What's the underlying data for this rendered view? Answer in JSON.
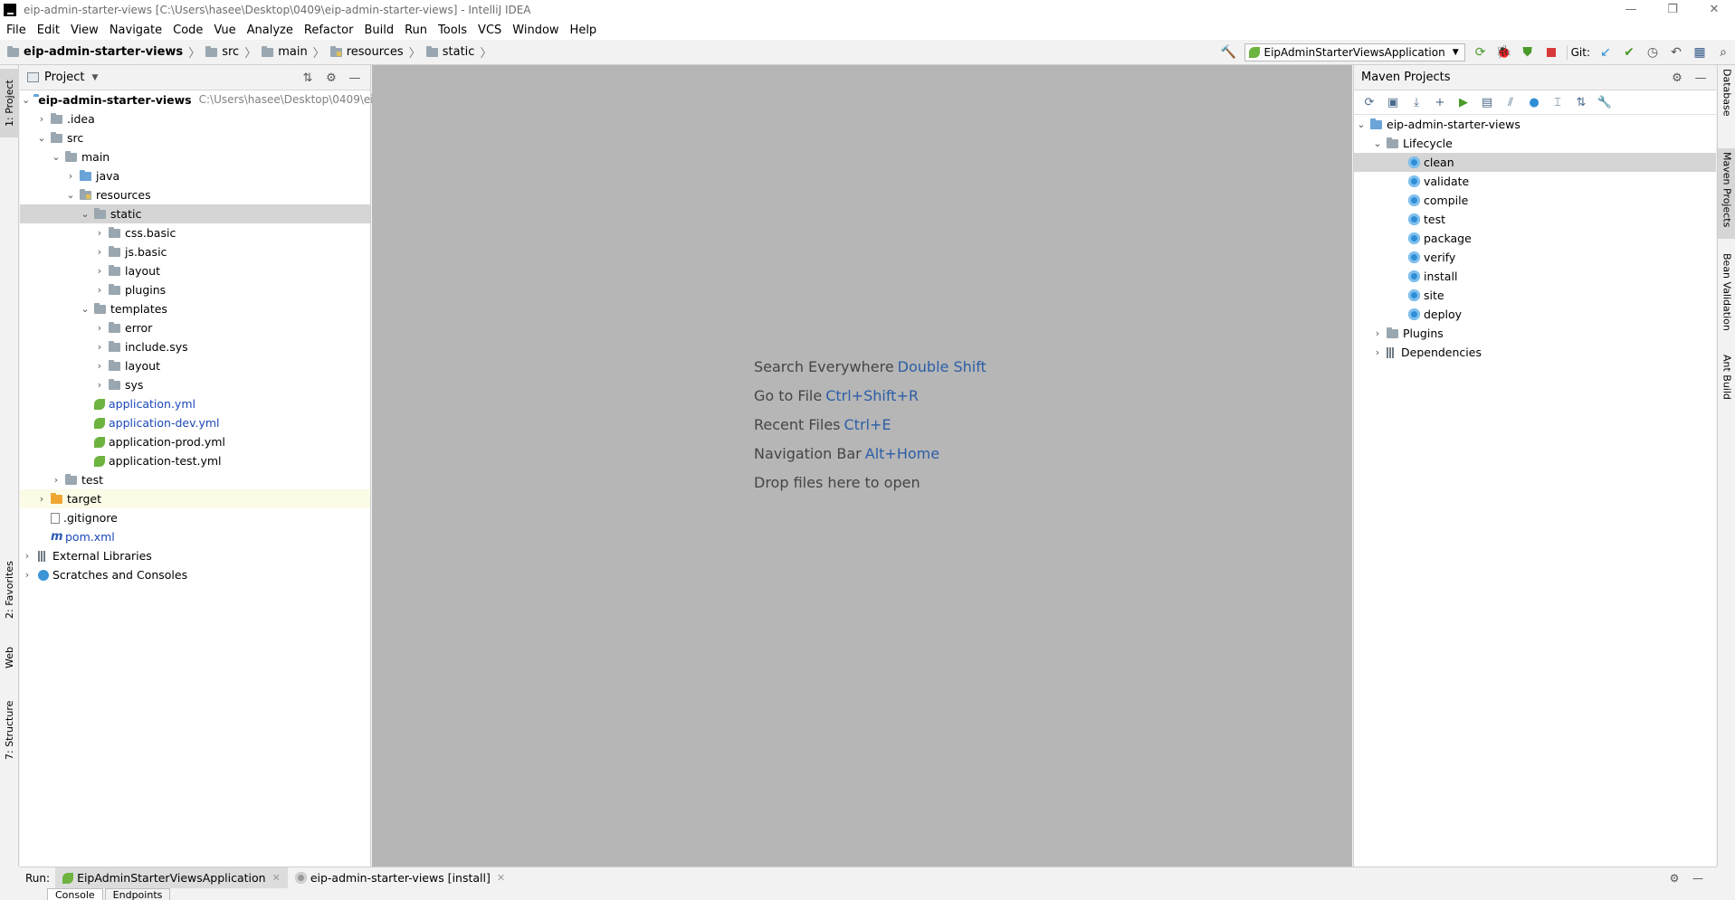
{
  "window": {
    "title": "eip-admin-starter-views [C:\\Users\\hasee\\Desktop\\0409\\eip-admin-starter-views] - IntelliJ IDEA",
    "minimize": "—",
    "restore": "❐",
    "close": "✕"
  },
  "menu": [
    "File",
    "Edit",
    "View",
    "Navigate",
    "Code",
    "Vue",
    "Analyze",
    "Refactor",
    "Build",
    "Run",
    "Tools",
    "VCS",
    "Window",
    "Help"
  ],
  "breadcrumb": [
    "eip-admin-starter-views",
    "src",
    "main",
    "resources",
    "static"
  ],
  "toolbar": {
    "run_config": "EipAdminStarterViewsApplication",
    "git_label": "Git:"
  },
  "left_stripe": {
    "project": "1: Project",
    "favorites": "2: Favorites",
    "web": "Web",
    "structure": "7: Structure"
  },
  "project_panel": {
    "title": "Project",
    "root_name": "eip-admin-starter-views",
    "root_path": "C:\\Users\\hasee\\Desktop\\0409\\eip",
    "items": {
      "idea": ".idea",
      "src": "src",
      "main": "main",
      "java": "java",
      "resources": "resources",
      "static": "static",
      "css_basic": "css.basic",
      "js_basic": "js.basic",
      "layout1": "layout",
      "plugins": "plugins",
      "templates": "templates",
      "error": "error",
      "include_sys": "include.sys",
      "layout2": "layout",
      "sys": "sys",
      "app_yml": "application.yml",
      "app_dev": "application-dev.yml",
      "app_prod": "application-prod.yml",
      "app_test": "application-test.yml",
      "test": "test",
      "target": "target",
      "gitignore": ".gitignore",
      "pom": "pom.xml",
      "ext_libs": "External Libraries",
      "scratches": "Scratches and Consoles"
    }
  },
  "editor": {
    "hints": [
      {
        "label": "Search Everywhere",
        "key": "Double Shift"
      },
      {
        "label": "Go to File",
        "key": "Ctrl+Shift+R"
      },
      {
        "label": "Recent Files",
        "key": "Ctrl+E"
      },
      {
        "label": "Navigation Bar",
        "key": "Alt+Home"
      },
      {
        "label": "Drop files here to open",
        "key": ""
      }
    ]
  },
  "maven_panel": {
    "title": "Maven Projects",
    "project": "eip-admin-starter-views",
    "lifecycle": "Lifecycle",
    "goals": [
      "clean",
      "validate",
      "compile",
      "test",
      "package",
      "verify",
      "install",
      "site",
      "deploy"
    ],
    "plugins": "Plugins",
    "dependencies": "Dependencies"
  },
  "right_stripe": {
    "database": "Database",
    "maven": "Maven Projects",
    "bean": "Bean Validation",
    "ant": "Ant Build"
  },
  "run_bar": {
    "label": "Run:",
    "tabs": [
      "EipAdminStarterViewsApplication",
      "eip-admin-starter-views [install]"
    ],
    "console": "Console",
    "endpoints": "Endpoints"
  },
  "colors": {
    "editor_bg": "#b6b6b6",
    "shortcut_blue": "#2c5ea6",
    "selection": "#d5d5d5"
  }
}
